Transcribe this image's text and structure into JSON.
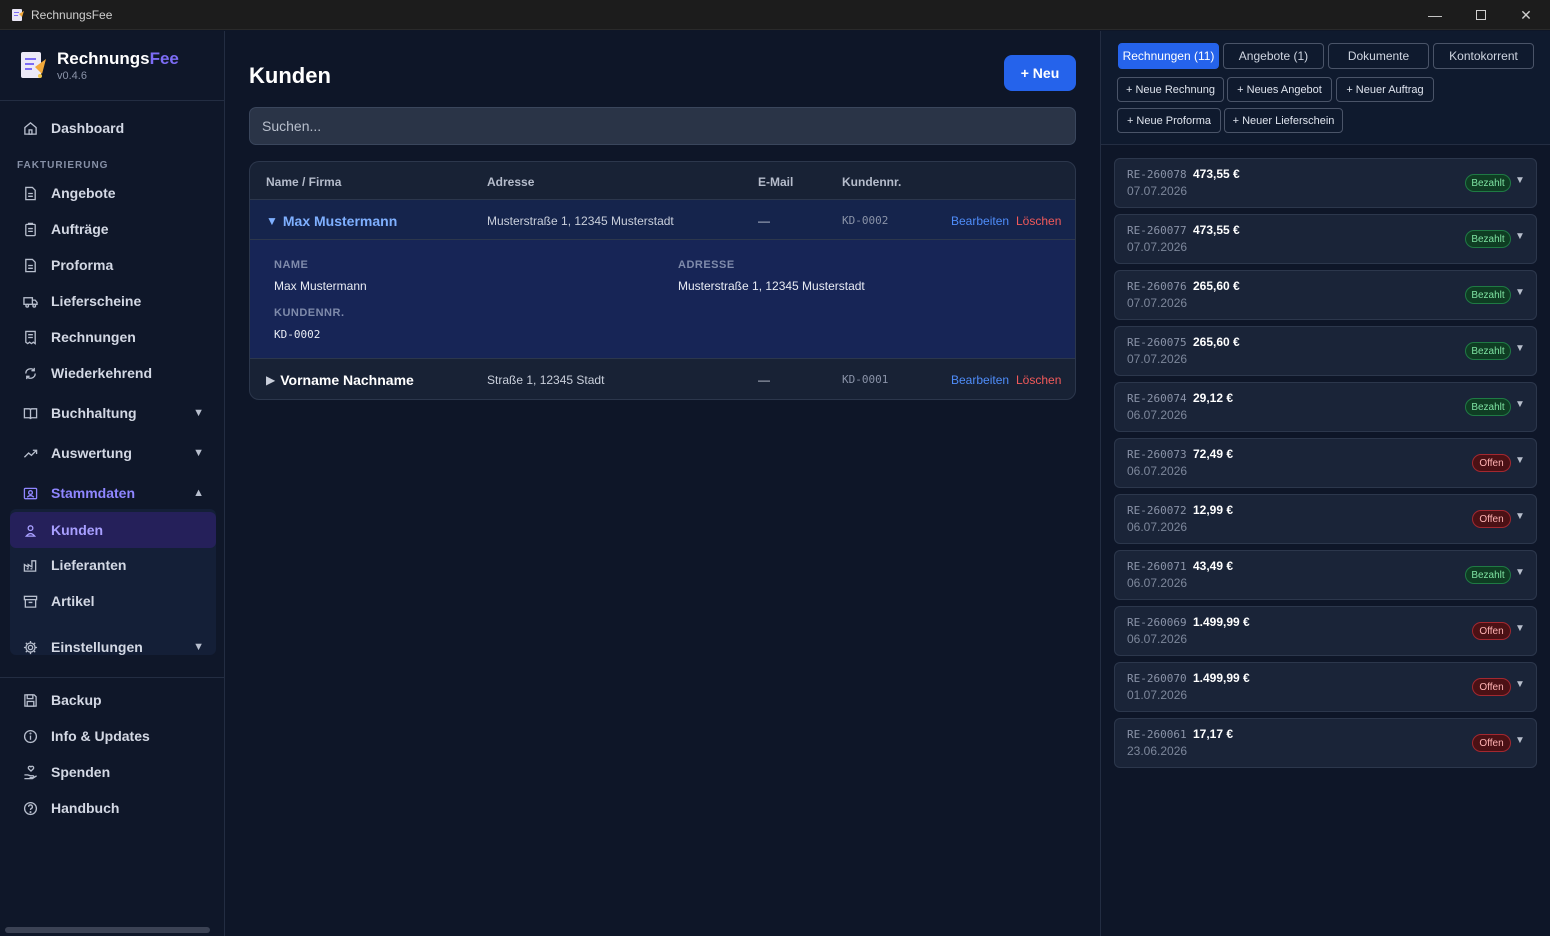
{
  "window": {
    "title": "RechnungsFee"
  },
  "brand": {
    "name_main": "Rechnungs",
    "name_accent": "Fee",
    "version": "v0.4.6"
  },
  "sidebar": {
    "dashboard": "Dashboard",
    "section_fakturierung": "FAKTURIERUNG",
    "items": [
      {
        "label": "Angebote",
        "icon": "file-icon"
      },
      {
        "label": "Aufträge",
        "icon": "clipboard-icon"
      },
      {
        "label": "Proforma",
        "icon": "file-icon"
      },
      {
        "label": "Lieferscheine",
        "icon": "truck-icon"
      },
      {
        "label": "Rechnungen",
        "icon": "receipt-icon"
      },
      {
        "label": "Wiederkehrend",
        "icon": "repeat-icon"
      }
    ],
    "buchhaltung": "Buchhaltung",
    "auswertung": "Auswertung",
    "stammdaten": "Stammdaten",
    "kunden": "Kunden",
    "lieferanten": "Lieferanten",
    "artikel": "Artikel",
    "einstellungen": "Einstellungen",
    "backup": "Backup",
    "info": "Info & Updates",
    "spenden": "Spenden",
    "handbuch": "Handbuch"
  },
  "main": {
    "title": "Kunden",
    "new_button": "+ Neu",
    "search_placeholder": "Suchen...",
    "columns": [
      "Name / Firma",
      "Adresse",
      "E-Mail",
      "Kundennr."
    ],
    "edit_label": "Bearbeiten",
    "delete_label": "Löschen",
    "customers": [
      {
        "name": "Max Mustermann",
        "address": "Musterstraße 1, 12345 Musterstadt",
        "email": "—",
        "number": "KD-0002",
        "expanded": true
      },
      {
        "name": "Vorname Nachname",
        "address": "Straße 1, 12345 Stadt",
        "email": "—",
        "number": "KD-0001",
        "expanded": false
      }
    ],
    "details": {
      "name_label": "NAME",
      "name_value": "Max Mustermann",
      "address_label": "ADRESSE",
      "address_value": "Musterstraße 1, 12345 Musterstadt",
      "number_label": "KUNDENNR.",
      "number_value": "KD-0002"
    }
  },
  "right_panel": {
    "tabs": [
      "Rechnungen (11)",
      "Angebote (1)",
      "Dokumente",
      "Kontokorrent"
    ],
    "quick_actions": [
      "+ Neue Rechnung",
      "+ Neues Angebot",
      "+ Neuer Auftrag",
      "+ Neue Proforma",
      "+ Neuer Lieferschein"
    ],
    "invoices": [
      {
        "number": "RE-260078",
        "amount": "473,55 €",
        "date": "07.07.2026",
        "status": "Bezahlt"
      },
      {
        "number": "RE-260077",
        "amount": "473,55 €",
        "date": "07.07.2026",
        "status": "Bezahlt"
      },
      {
        "number": "RE-260076",
        "amount": "265,60 €",
        "date": "07.07.2026",
        "status": "Bezahlt"
      },
      {
        "number": "RE-260075",
        "amount": "265,60 €",
        "date": "07.07.2026",
        "status": "Bezahlt"
      },
      {
        "number": "RE-260074",
        "amount": "29,12 €",
        "date": "06.07.2026",
        "status": "Bezahlt"
      },
      {
        "number": "RE-260073",
        "amount": "72,49 €",
        "date": "06.07.2026",
        "status": "Offen"
      },
      {
        "number": "RE-260072",
        "amount": "12,99 €",
        "date": "06.07.2026",
        "status": "Offen"
      },
      {
        "number": "RE-260071",
        "amount": "43,49 €",
        "date": "06.07.2026",
        "status": "Bezahlt"
      },
      {
        "number": "RE-260069",
        "amount": "1.499,99 €",
        "date": "06.07.2026",
        "status": "Offen"
      },
      {
        "number": "RE-260070",
        "amount": "1.499,99 €",
        "date": "01.07.2026",
        "status": "Offen"
      },
      {
        "number": "RE-260061",
        "amount": "17,17 €",
        "date": "23.06.2026",
        "status": "Offen"
      }
    ]
  },
  "colors": {
    "accent": "#2563eb",
    "brand_accent": "#7c6cf5",
    "paid": "#7ee3a2",
    "open": "#ffb3b3",
    "delete": "#f25a5a"
  }
}
